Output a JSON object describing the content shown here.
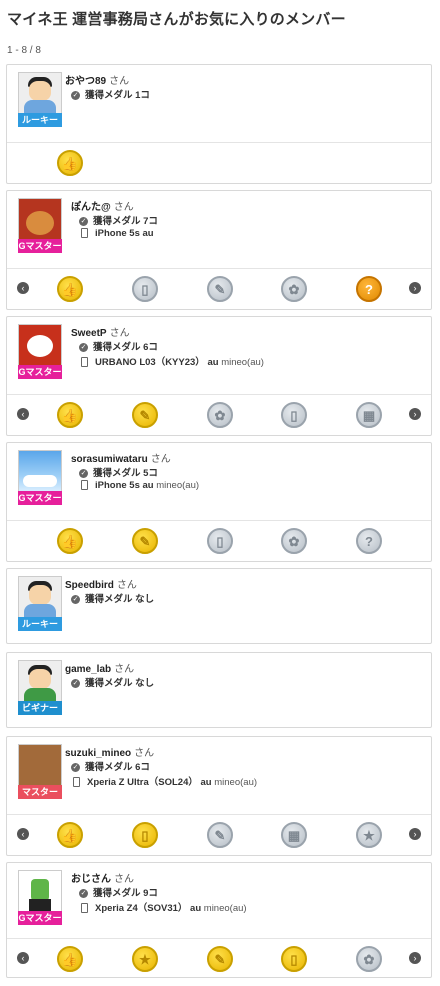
{
  "page": {
    "title": "マイネ王 運営事務局さんがお気に入りのメンバー",
    "count": "1 - 8 / 8"
  },
  "icons": {
    "prev": "chevron-left-icon",
    "next": "chevron-right-icon",
    "medal_check": "check-circle-icon",
    "phone": "smartphone-icon"
  },
  "members": [
    {
      "name": "おやつ89",
      "san": "さん",
      "badge": "ルーキー",
      "medal_text": "獲得メダル 1コ",
      "device": "",
      "carrier": "",
      "mvno": "",
      "medals": [
        "thumbs-up-gold"
      ]
    },
    {
      "name": "ぽんた@",
      "san": "さん",
      "badge": "Gマスター",
      "medal_text": "獲得メダル 7コ",
      "device": "iPhone 5s",
      "carrier": "au",
      "mvno": "",
      "medals": [
        "thumbs-up-gold",
        "phone-silver",
        "feather-silver",
        "flower-silver",
        "question-orange"
      ]
    },
    {
      "name": "SweetP",
      "san": "さん",
      "badge": "Gマスター",
      "medal_text": "獲得メダル 6コ",
      "device": "URBANO L03（KYY23）",
      "carrier": "au",
      "mvno": "mineo(au)",
      "medals": [
        "thumbs-up-gold",
        "feather-gold",
        "flower-silver",
        "phone-silver",
        "grid-silver"
      ]
    },
    {
      "name": "sorasumiwataru",
      "san": "さん",
      "badge": "Gマスター",
      "medal_text": "獲得メダル 5コ",
      "device": "iPhone 5s",
      "carrier": "au",
      "mvno": "mineo(au)",
      "medals": [
        "thumbs-up-gold",
        "feather-gold",
        "phone-silver",
        "flower-silver",
        "question-silver"
      ]
    },
    {
      "name": "Speedbird",
      "san": "さん",
      "badge": "ルーキー",
      "medal_text": "獲得メダル なし",
      "device": "",
      "carrier": "",
      "mvno": "",
      "medals": []
    },
    {
      "name": "game_lab",
      "san": "さん",
      "badge": "ビギナー",
      "medal_text": "獲得メダル なし",
      "device": "",
      "carrier": "",
      "mvno": "",
      "medals": []
    },
    {
      "name": "suzuki_mineo",
      "san": "さん",
      "badge": "マスター",
      "medal_text": "獲得メダル 6コ",
      "device": "Xperia Z Ultra（SOL24）",
      "carrier": "au",
      "mvno": "mineo(au)",
      "medals": [
        "thumbs-up-gold",
        "phone-gold",
        "feather-silver",
        "grid-silver",
        "star-silver"
      ]
    },
    {
      "name": "おじさん",
      "san": "さん",
      "badge": "Gマスター",
      "medal_text": "獲得メダル 9コ",
      "device": "Xperia Z4（SOV31）",
      "carrier": "au",
      "mvno": "mineo(au)",
      "medals": [
        "thumbs-up-gold",
        "star-gold",
        "feather-gold",
        "phone-gold",
        "flower-silver"
      ]
    }
  ],
  "medal_glyphs": {
    "thumbs-up": "👍",
    "phone": "▯",
    "feather": "✎",
    "flower": "✿",
    "grid": "▦",
    "star": "★",
    "question": "?"
  }
}
